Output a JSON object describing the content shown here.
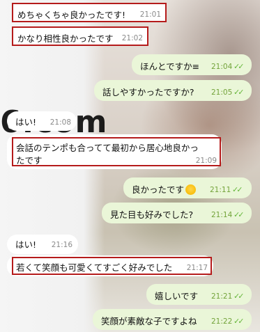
{
  "watermark": "6.com",
  "messages": [
    {
      "text": "めちゃくちゃ良かったです!",
      "time": "21:01"
    },
    {
      "text": "かなり相性良かったです",
      "time": "21:02"
    },
    {
      "text": "ほんとですか≡",
      "time": "21:04"
    },
    {
      "text": "話しやすかったですか?",
      "time": "21:05"
    },
    {
      "text": "はい!",
      "time": "21:08"
    },
    {
      "text": "会話のテンポも合ってて最初から居心地良かったです",
      "line1": "会話のテンポも合ってて最初から居心地良かっ",
      "line2": "たです",
      "time": "21:09"
    },
    {
      "text": "良かったです",
      "time": "21:11",
      "emoji": "smiling-face-emoji"
    },
    {
      "text": "見た目も好みでした?",
      "time": "21:14"
    },
    {
      "text": "はい!",
      "time": "21:16"
    },
    {
      "text": "若くて笑顔も可愛くてすごく好みでした",
      "time": "21:17"
    },
    {
      "text": "嬉しいです",
      "time": "21:21"
    },
    {
      "text": "笑顔が素敵な子ですよね",
      "time": "21:22"
    }
  ],
  "read_mark": "✓✓",
  "colors": {
    "incoming": "#ffffff",
    "outgoing": "#eaf6d8",
    "highlight": "#b51b1b",
    "read": "#65b63a"
  }
}
